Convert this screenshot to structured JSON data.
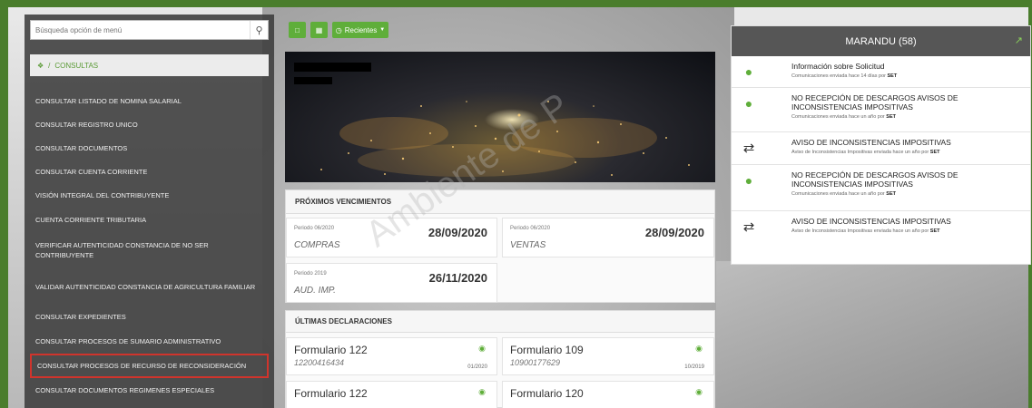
{
  "sidebar": {
    "search_placeholder": "Búsqueda opción de menú",
    "breadcrumb": {
      "home_icon": "home-icon",
      "separator": "/",
      "label": "CONSULTAS"
    },
    "items": [
      {
        "label": "CONSULTAR LISTADO DE NOMINA SALARIAL",
        "selected": false
      },
      {
        "label": "CONSULTAR REGISTRO UNICO",
        "selected": false
      },
      {
        "label": "CONSULTAR DOCUMENTOS",
        "selected": false
      },
      {
        "label": "CONSULTAR CUENTA CORRIENTE",
        "selected": false
      },
      {
        "label": "VISIÓN INTEGRAL DEL CONTRIBUYENTE",
        "selected": false
      },
      {
        "label": "CUENTA CORRIENTE TRIBUTARIA",
        "selected": false
      },
      {
        "label": "VERIFICAR AUTENTICIDAD CONSTANCIA DE NO SER CONTRIBUYENTE",
        "selected": false
      },
      {
        "label": "VALIDAR AUTENTICIDAD CONSTANCIA DE AGRICULTURA FAMILIAR",
        "selected": false
      },
      {
        "label": "CONSULTAR EXPEDIENTES",
        "selected": false
      },
      {
        "label": "CONSULTAR PROCESOS DE SUMARIO ADMINISTRATIVO",
        "selected": false
      },
      {
        "label": "CONSULTAR PROCESOS DE RECURSO DE RECONSIDERACIÓN",
        "selected": true
      },
      {
        "label": "CONSULTAR DOCUMENTOS REGIMENES ESPECIALES",
        "selected": false
      }
    ]
  },
  "toolbar": {
    "recientes_label": "Recientes"
  },
  "vencimientos": {
    "title": "PRÓXIMOS VENCIMIENTOS",
    "cards": [
      {
        "period": "Periodo 06/2020",
        "date": "28/09/2020",
        "type": "COMPRAS"
      },
      {
        "period": "Periodo 06/2020",
        "date": "28/09/2020",
        "type": "VENTAS"
      },
      {
        "period": "Periodo 2019",
        "date": "26/11/2020",
        "type": "AUD. IMP."
      }
    ]
  },
  "declaraciones": {
    "title": "ÚLTIMAS DECLARACIONES",
    "cards": [
      {
        "form": "Formulario 122",
        "number": "12200416434",
        "period": "01/2020"
      },
      {
        "form": "Formulario 109",
        "number": "10900177629",
        "period": "10/2019"
      },
      {
        "form": "Formulario 122",
        "number": "",
        "period": ""
      },
      {
        "form": "Formulario 120",
        "number": "",
        "period": ""
      }
    ]
  },
  "marandu": {
    "title": "MARANDU (58)",
    "items": [
      {
        "icon": "comment-icon",
        "title": "Información sobre Solicitud",
        "sub": "Comunicaciones enviada hace 14 días por",
        "by": "SET"
      },
      {
        "icon": "comment-icon",
        "title": "NO RECEPCIÓN DE DESCARGOS AVISOS DE INCONSISTENCIAS IMPOSITIVAS",
        "sub": "Comunicaciones enviada hace un año por",
        "by": "SET"
      },
      {
        "icon": "shuffle-icon",
        "title": "AVISO DE INCONSISTENCIAS IMPOSITIVAS",
        "sub": "Aviso de Inconsistencias Impositivas enviada hace un año por",
        "by": "SET"
      },
      {
        "icon": "comment-icon",
        "title": "NO RECEPCIÓN DE DESCARGOS AVISOS DE INCONSISTENCIAS IMPOSITIVAS",
        "sub": "Comunicaciones enviada hace un año por",
        "by": "SET"
      },
      {
        "icon": "shuffle-icon",
        "title": "AVISO DE INCONSISTENCIAS IMPOSITIVAS",
        "sub": "Aviso de Inconsistencias Impositivas enviada hace un año por",
        "by": "SET"
      }
    ]
  },
  "watermark": "Ambiente de P",
  "colors": {
    "frame": "#4a7d2c",
    "accent_green": "#5fae3a",
    "selected_border": "#d0342c",
    "sidebar_bg": "#3c3c3c",
    "header_dark": "#565656"
  }
}
